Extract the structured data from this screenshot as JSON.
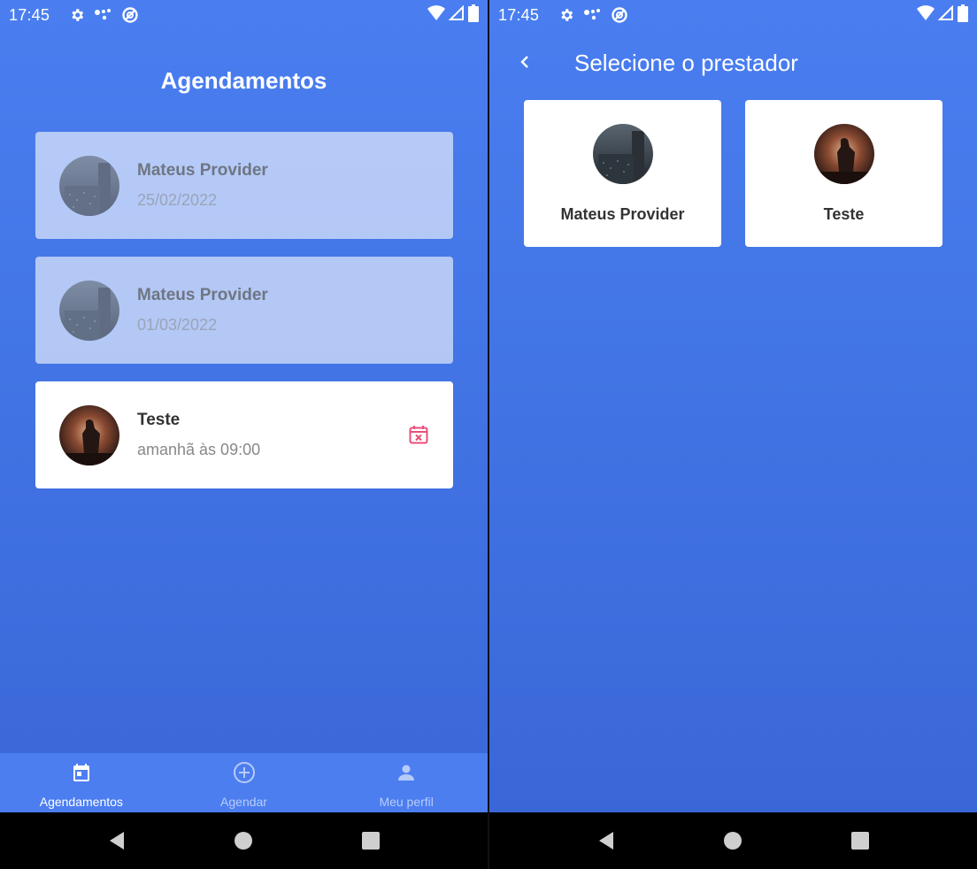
{
  "status_bar": {
    "time": "17:45"
  },
  "left_screen": {
    "title": "Agendamentos",
    "appointments": [
      {
        "name": "Mateus Provider",
        "date": "25/02/2022",
        "state": "past",
        "avatar": "city-rain-avatar"
      },
      {
        "name": "Mateus Provider",
        "date": "01/03/2022",
        "state": "past",
        "avatar": "city-rain-avatar"
      },
      {
        "name": "Teste",
        "date": "amanhã às 09:00",
        "state": "upcoming",
        "avatar": "warrior-sunset-avatar"
      }
    ],
    "tabs": [
      {
        "label": "Agendamentos",
        "icon": "calendar-icon",
        "active": true
      },
      {
        "label": "Agendar",
        "icon": "add-circle-icon",
        "active": false
      },
      {
        "label": "Meu perfil",
        "icon": "person-icon",
        "active": false
      }
    ]
  },
  "right_screen": {
    "title": "Selecione o prestador",
    "providers": [
      {
        "name": "Mateus Provider",
        "avatar": "city-rain-avatar"
      },
      {
        "name": "Teste",
        "avatar": "warrior-sunset-avatar"
      }
    ]
  },
  "colors": {
    "background_top": "#4a7ef0",
    "background_bottom": "#3a67d8",
    "tab_bar": "#4c7ef0",
    "cancel_icon": "#e8507a"
  }
}
